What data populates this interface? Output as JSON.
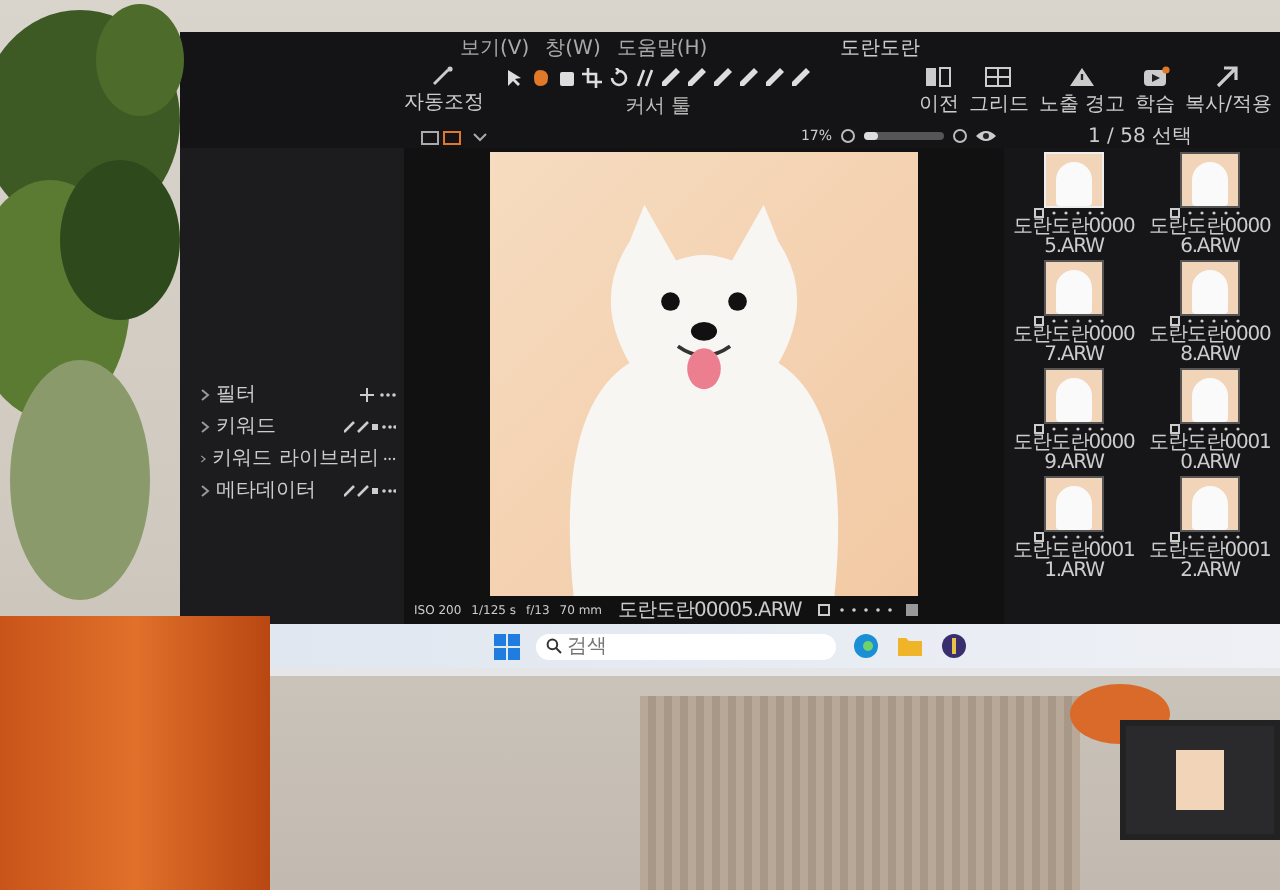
{
  "menu_bar": {
    "items": [
      "보기(V)",
      "창(W)",
      "도움말(H)"
    ],
    "title": "도란도란"
  },
  "toolbar": {
    "auto_adjust": "자동조정",
    "cursor_tools": "커서 툴",
    "right_tools": [
      {
        "label": "이전"
      },
      {
        "label": "그리드"
      },
      {
        "label": "노출 경고"
      },
      {
        "label": "학습"
      },
      {
        "label": "복사/적용"
      }
    ]
  },
  "viewer_bar": {
    "zoom": "17%",
    "zoom_slider": {
      "level": 0.17
    },
    "selection": "1 / 58 선택"
  },
  "sidebar": {
    "sections": [
      {
        "label": "필터",
        "kind": "add"
      },
      {
        "label": "키워드",
        "kind": "tools"
      },
      {
        "label": "키워드 라이브러리",
        "kind": "more"
      },
      {
        "label": "메타데이터",
        "kind": "tools"
      }
    ]
  },
  "photo_info": {
    "exif": [
      "ISO 200",
      "1/125 s",
      "f/13",
      "70 mm"
    ],
    "filename": "도란도란00005.ARW"
  },
  "thumbnails": [
    {
      "label": "도란도란00005.ARW",
      "selected": true
    },
    {
      "label": "도란도란00006.ARW",
      "selected": false
    },
    {
      "label": "도란도란00007.ARW",
      "selected": false
    },
    {
      "label": "도란도란00008.ARW",
      "selected": false
    },
    {
      "label": "도란도란00009.ARW",
      "selected": false
    },
    {
      "label": "도란도란00010.ARW",
      "selected": false
    },
    {
      "label": "도란도란00011.ARW",
      "selected": false
    },
    {
      "label": "도란도란00012.ARW",
      "selected": false
    }
  ],
  "taskbar": {
    "search": {
      "placeholder": "검색"
    }
  }
}
